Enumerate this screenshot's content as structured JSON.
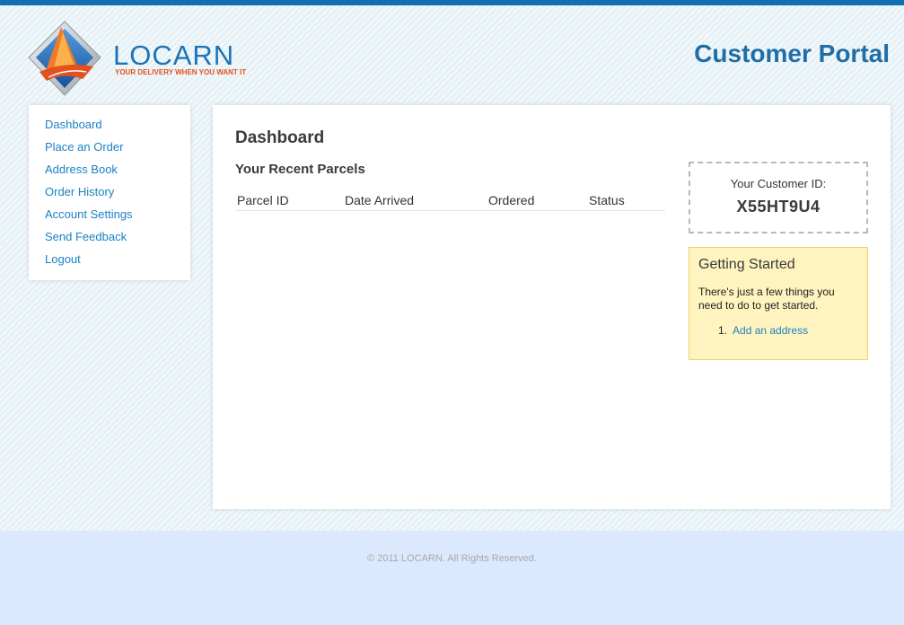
{
  "header": {
    "logo_text": "LOCARN",
    "logo_tagline": "YOUR DELIVERY WHEN YOU WANT IT",
    "portal_title": "Customer Portal"
  },
  "sidebar": {
    "items": [
      {
        "label": "Dashboard"
      },
      {
        "label": "Place an Order"
      },
      {
        "label": "Address Book"
      },
      {
        "label": "Order History"
      },
      {
        "label": "Account Settings"
      },
      {
        "label": "Send Feedback"
      },
      {
        "label": "Logout"
      }
    ]
  },
  "main": {
    "title": "Dashboard",
    "recent_title": "Your Recent Parcels",
    "table": {
      "columns": [
        "Parcel ID",
        "Date Arrived",
        "Ordered",
        "Status"
      ],
      "rows": []
    },
    "customer_id": {
      "label": "Your Customer ID:",
      "value": "X55HT9U4"
    },
    "getting_started": {
      "title": "Getting Started",
      "text": "There's just a few things you need to do to get started.",
      "steps": [
        {
          "number": "1.",
          "label": "Add an address"
        }
      ]
    }
  },
  "footer": {
    "text": "© 2011 LOCARN. All Rights Reserved."
  },
  "colors": {
    "brand_blue": "#1f6ea8",
    "link_blue": "#1a82c4",
    "accent_orange": "#e2511e",
    "notice_yellow": "#fff4bf"
  }
}
